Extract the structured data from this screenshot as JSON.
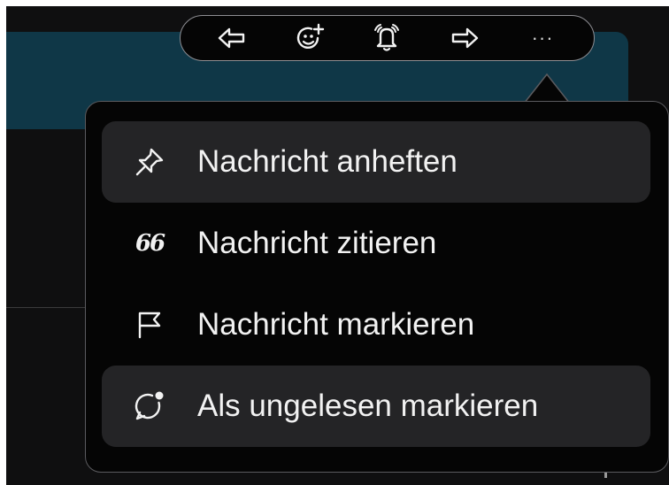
{
  "toolbar": {
    "actions": [
      {
        "name": "reply",
        "icon": "reply-arrow-icon"
      },
      {
        "name": "add-reaction",
        "icon": "add-emoji-icon"
      },
      {
        "name": "notify",
        "icon": "bell-icon"
      },
      {
        "name": "forward",
        "icon": "forward-arrow-icon"
      },
      {
        "name": "more",
        "icon": "more-horizontal-icon",
        "label": "···"
      }
    ]
  },
  "menu": {
    "items": [
      {
        "label": "Nachricht anheften",
        "icon": "pin-icon",
        "highlighted": true
      },
      {
        "label": "Nachricht zitieren",
        "icon": "quote-icon",
        "glyph": "66",
        "highlighted": false
      },
      {
        "label": "Nachricht markieren",
        "icon": "flag-icon",
        "highlighted": false
      },
      {
        "label": "Als ungelesen markieren",
        "icon": "unread-bubble-icon",
        "highlighted": true
      }
    ]
  },
  "colors": {
    "background": "#0f0f10",
    "message_bubble": "#0f3747",
    "menu_background": "#050505",
    "menu_highlight": "#242426",
    "text": "#f2f2f2"
  }
}
